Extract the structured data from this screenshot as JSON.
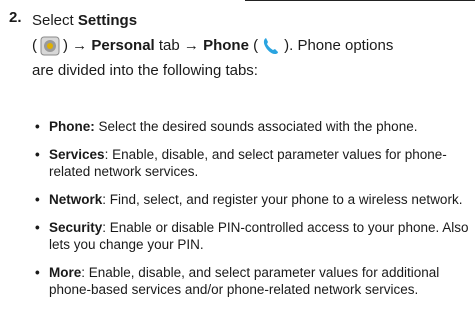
{
  "step": {
    "number": "2.",
    "select_word": "Select",
    "settings_label": "Settings",
    "open_paren": "(",
    "close_paren_arrow": ") →",
    "personal_label": "Personal",
    "tab_arrow": "tab →",
    "phone_label": "Phone",
    "open_paren2": "(",
    "close_paren_period": ").",
    "tail_1": "Phone options",
    "tail_2": "are divided into the following tabs:",
    "settings_icon": "settings-gear-icon",
    "phone_icon": "phone-handset-icon",
    "colors": {
      "gear": "#9a9a9a",
      "gear_accent": "#e0b000",
      "phone": "#2aa4e0"
    }
  },
  "bullets": [
    {
      "term": "Phone:",
      "desc": " Select the desired sounds associated with the phone."
    },
    {
      "term": "Services",
      "desc": ": Enable, disable, and select parameter values for phone-related network services."
    },
    {
      "term": "Network",
      "desc": ": Find, select, and register your phone to a wireless network."
    },
    {
      "term": "Security",
      "desc": ": Enable or disable PIN-controlled access to your phone. Also lets you change your PIN."
    },
    {
      "term": "More",
      "desc": ": Enable, disable, and select parameter values for additional phone-based services and/or phone-related network services."
    }
  ]
}
